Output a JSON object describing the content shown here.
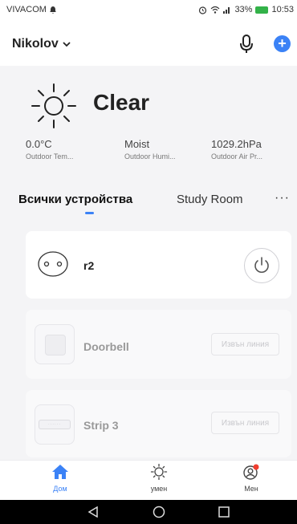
{
  "status": {
    "carrier": "VIVACOM",
    "battery": "33%",
    "time": "10:53"
  },
  "header": {
    "home_name": "Nikolov"
  },
  "weather": {
    "condition": "Clear",
    "stats": [
      {
        "value": "0.0°C",
        "label": "Outdoor Tem..."
      },
      {
        "value": "Moist",
        "label": "Outdoor Humi..."
      },
      {
        "value": "1029.2hPa",
        "label": "Outdoor Air Pr..."
      }
    ]
  },
  "tabs": {
    "active": "Всички устройства",
    "other": "Study Room",
    "more": "···"
  },
  "devices": [
    {
      "name": "r2",
      "online": true
    },
    {
      "name": "Doorbell",
      "status": "Извън линия"
    },
    {
      "name": "Strip 3",
      "status": "Извън линия"
    }
  ],
  "nav": {
    "home": "Дом",
    "smart": "умен",
    "me": "Мен"
  },
  "colors": {
    "accent": "#3b82f6",
    "badge": "#f03e2f"
  }
}
